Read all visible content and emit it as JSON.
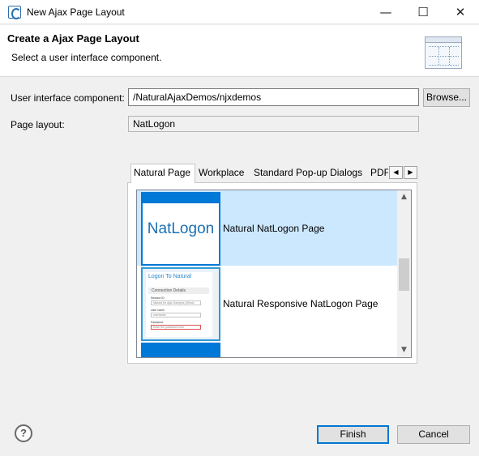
{
  "window": {
    "title": "New Ajax Page Layout",
    "minimize_glyph": "—",
    "maximize_glyph": "☐",
    "close_glyph": "✕"
  },
  "header": {
    "title": "Create a Ajax Page Layout",
    "description": "Select a user interface component."
  },
  "form": {
    "ui_component_label": "User interface component:",
    "ui_component_value": "/NaturalAjaxDemos/njxdemos",
    "browse_label": "Browse...",
    "page_layout_label": "Page layout:",
    "page_layout_value": "NatLogon"
  },
  "tabs": [
    {
      "label": "Natural Page",
      "active": true
    },
    {
      "label": "Workplace",
      "active": false
    },
    {
      "label": "Standard Pop-up Dialogs",
      "active": false
    },
    {
      "label": "PDF",
      "active": false
    }
  ],
  "tab_scroll": {
    "left_glyph": "◀",
    "right_glyph": "▶"
  },
  "layouts": [
    {
      "label": "Natural NatLogon Page",
      "selected": true,
      "thumbnail_text": "NatLogon"
    },
    {
      "label": "Natural Responsive NatLogon Page",
      "selected": false,
      "thumbnail": {
        "heading": "Logon To Natural",
        "section": "Connection Details",
        "session_label": "Session ID",
        "session_value": "Natural for Ajax Samples (Windo",
        "user_label": "User name",
        "user_value": "username",
        "password_label": "Password",
        "password_value": "Enter the password here"
      }
    }
  ],
  "scrollbar": {
    "up_glyph": "▲",
    "down_glyph": "▼"
  },
  "footer": {
    "help_glyph": "?",
    "finish_label": "Finish",
    "cancel_label": "Cancel"
  },
  "colors": {
    "accent": "#0078d7",
    "selection": "#cce8ff",
    "thumbnail_logo": "#1a6fb5"
  }
}
